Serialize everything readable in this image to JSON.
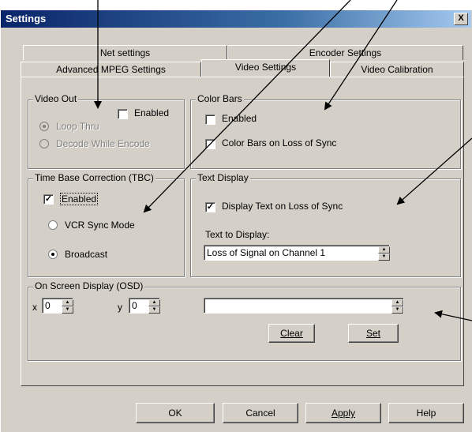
{
  "window": {
    "title": "Settings",
    "close_label": "X"
  },
  "tabs": {
    "row_back": [
      "Net settings",
      "Encoder Settings"
    ],
    "row_front": [
      "Advanced MPEG Settings",
      "Video Settings",
      "Video Calibration"
    ],
    "active": "Video Settings"
  },
  "video_out": {
    "legend": "Video Out",
    "enabled_label": "Enabled",
    "enabled_checked": false,
    "loop_thru_label": "Loop Thru",
    "decode_while_encode_label": "Decode While Encode"
  },
  "color_bars": {
    "legend": "Color Bars",
    "enabled_label": "Enabled",
    "enabled_checked": false,
    "loss_of_sync_label": "Color Bars on Loss of Sync",
    "loss_of_sync_checked": false
  },
  "tbc": {
    "legend": "Time Base Correction (TBC)",
    "enabled_label": "Enabled",
    "enabled_checked": true,
    "vcr_sync_label": "VCR Sync Mode",
    "broadcast_label": "Broadcast",
    "selected": "Broadcast"
  },
  "text_display": {
    "legend": "Text Display",
    "display_text_label": "Display Text on Loss of Sync",
    "display_text_checked": true,
    "text_to_display_label": "Text to Display:",
    "text_to_display_value": "Loss of Signal on Channel 1"
  },
  "osd": {
    "legend": "On Screen Display (OSD)",
    "x_label": "x",
    "x_value": "0",
    "y_label": "y",
    "y_value": "0",
    "text_value": "",
    "clear_label": "Clear",
    "set_label": "Set"
  },
  "footer": {
    "ok_label": "OK",
    "cancel_label": "Cancel",
    "apply_label": "Apply",
    "help_label": "Help"
  },
  "colors": {
    "dialog_bg": "#d4d0c8",
    "title_start": "#0a246a",
    "title_end": "#a6caf0"
  }
}
